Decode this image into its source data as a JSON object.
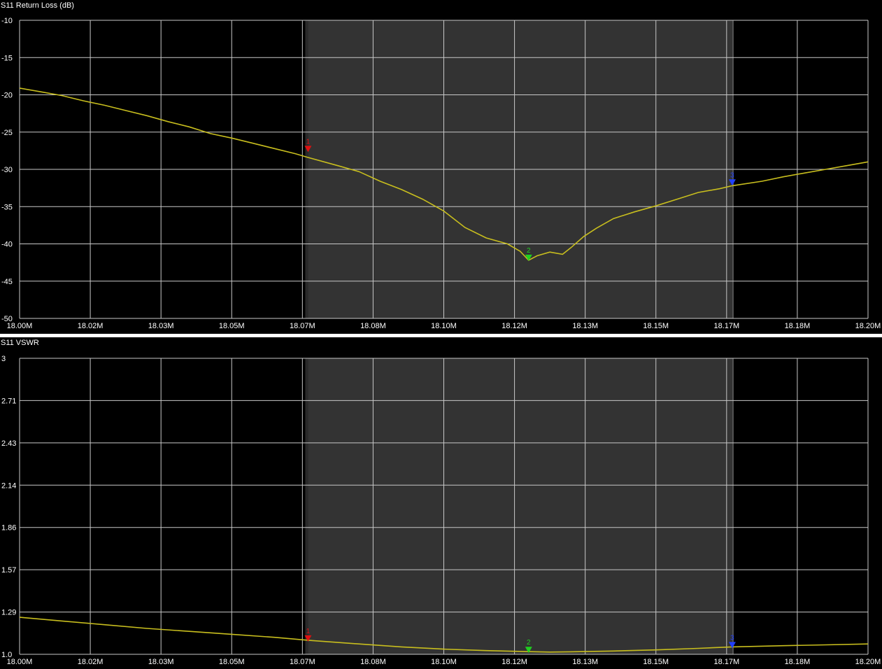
{
  "colors": {
    "background": "#000000",
    "grid": "#c8c8c8",
    "span_shading": "#333333",
    "trace": "#c8be1e",
    "marker1": "#e01010",
    "marker2": "#20d020",
    "marker3": "#2040ff"
  },
  "chart_data": [
    {
      "type": "line",
      "title": "S11 Return Loss (dB)",
      "x_unit": "MHz",
      "x_ticks": [
        "18.00M",
        "18.02M",
        "18.03M",
        "18.05M",
        "18.07M",
        "18.08M",
        "18.10M",
        "18.12M",
        "18.13M",
        "18.15M",
        "18.17M",
        "18.18M",
        "18.20M"
      ],
      "y_ticks": [
        "-10",
        "-15",
        "-20",
        "-25",
        "-30",
        "-35",
        "-40",
        "-45",
        "-50"
      ],
      "xlim": [
        18.0,
        18.2
      ],
      "ylim": [
        -50,
        -10
      ],
      "grid": true,
      "shaded_span": [
        18.068,
        18.168
      ],
      "series": [
        {
          "x": [
            18.0,
            18.005,
            18.01,
            18.015,
            18.02,
            18.025,
            18.03,
            18.035,
            18.04,
            18.045,
            18.05,
            18.055,
            18.06,
            18.065,
            18.068,
            18.075,
            18.08,
            18.085,
            18.09,
            18.095,
            18.1,
            18.105,
            18.11,
            18.115,
            18.118,
            18.12,
            18.122,
            18.125,
            18.128,
            18.13,
            18.133,
            18.136,
            18.14,
            18.145,
            18.15,
            18.155,
            18.16,
            18.165,
            18.168,
            18.175,
            18.18,
            18.185,
            18.19,
            18.195,
            18.2
          ],
          "y": [
            -19.1,
            -19.6,
            -20.1,
            -20.8,
            -21.4,
            -22.1,
            -22.8,
            -23.6,
            -24.3,
            -25.2,
            -25.8,
            -26.5,
            -27.2,
            -27.9,
            -28.4,
            -29.5,
            -30.3,
            -31.6,
            -32.7,
            -34.0,
            -35.6,
            -37.8,
            -39.2,
            -40.0,
            -41.0,
            -42.2,
            -41.6,
            -41.1,
            -41.4,
            -40.5,
            -39.0,
            -37.9,
            -36.6,
            -35.7,
            -34.9,
            -34.0,
            -33.1,
            -32.6,
            -32.2,
            -31.6,
            -31.0,
            -30.5,
            -30.0,
            -29.5,
            -29.0
          ]
        }
      ],
      "markers": [
        {
          "label": "1",
          "x": 18.068,
          "y": -27.5,
          "color": "#e01010"
        },
        {
          "label": "2",
          "x": 18.12,
          "y": -42.1,
          "color": "#20d020"
        },
        {
          "label": "3",
          "x": 18.168,
          "y": -32.0,
          "color": "#2040ff"
        }
      ]
    },
    {
      "type": "line",
      "title": "S11 VSWR",
      "x_unit": "MHz",
      "x_ticks": [
        "18.00M",
        "18.02M",
        "18.03M",
        "18.05M",
        "18.07M",
        "18.08M",
        "18.10M",
        "18.12M",
        "18.13M",
        "18.15M",
        "18.17M",
        "18.18M",
        "18.20M"
      ],
      "y_ticks": [
        "3",
        "2.71",
        "2.43",
        "2.14",
        "1.86",
        "1.57",
        "1.29",
        "1.0"
      ],
      "xlim": [
        18.0,
        18.2
      ],
      "ylim": [
        1.0,
        3.0
      ],
      "grid": true,
      "shaded_span": [
        18.068,
        18.168
      ],
      "series": [
        {
          "x": [
            18.0,
            18.01,
            18.02,
            18.03,
            18.04,
            18.05,
            18.06,
            18.068,
            18.08,
            18.09,
            18.1,
            18.11,
            18.12,
            18.125,
            18.13,
            18.14,
            18.15,
            18.16,
            18.168,
            18.18,
            18.19,
            18.2
          ],
          "y": [
            1.25,
            1.225,
            1.2,
            1.175,
            1.155,
            1.135,
            1.115,
            1.095,
            1.07,
            1.05,
            1.035,
            1.025,
            1.018,
            1.015,
            1.017,
            1.022,
            1.03,
            1.04,
            1.05,
            1.058,
            1.064,
            1.07
          ]
        }
      ],
      "markers": [
        {
          "label": "1",
          "x": 18.068,
          "y": 1.095,
          "color": "#e01010"
        },
        {
          "label": "2",
          "x": 18.12,
          "y": 1.018,
          "color": "#20d020"
        },
        {
          "label": "3",
          "x": 18.168,
          "y": 1.05,
          "color": "#2040ff"
        }
      ]
    }
  ]
}
